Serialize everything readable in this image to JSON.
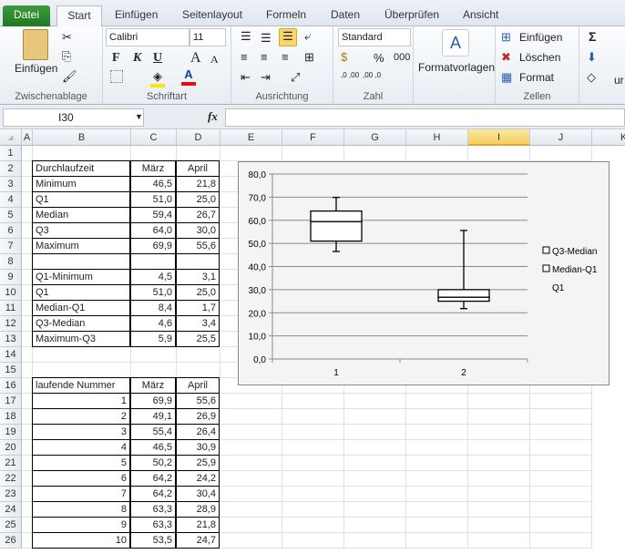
{
  "tabs": [
    "Datei",
    "Start",
    "Einfügen",
    "Seitenlayout",
    "Formeln",
    "Daten",
    "Überprüfen",
    "Ansicht"
  ],
  "ribbon": {
    "clipboard": {
      "paste": "Einfügen",
      "label": "Zwischenablage"
    },
    "font": {
      "name": "Calibri",
      "size": "11",
      "bold": "F",
      "italic": "K",
      "underline": "U",
      "grow": "A",
      "shrink": "A",
      "label": "Schriftart"
    },
    "align": {
      "label": "Ausrichtung"
    },
    "number": {
      "format": "Standard",
      "percent": "%",
      "thousands": "000",
      "inc": ",0 ,00",
      "dec": ",00 ,0",
      "label": "Zahl"
    },
    "styles": {
      "label": "Formatvorlagen"
    },
    "cells": {
      "insert": "Einfügen",
      "delete": "Löschen",
      "format": "Format",
      "label": "Zellen"
    },
    "editing": {
      "sum": "Σ",
      "more": "ur"
    }
  },
  "formula_bar": {
    "name_box": "I30",
    "fx": "fx",
    "value": ""
  },
  "columns": [
    "A",
    "B",
    "C",
    "D",
    "E",
    "F",
    "G",
    "H",
    "I",
    "J",
    "K"
  ],
  "selected_column": "I",
  "rows": [
    {
      "r": 1,
      "cells": []
    },
    {
      "r": 2,
      "cells": [
        "Durchlaufzeit",
        "März",
        "April"
      ],
      "border": true,
      "center": true
    },
    {
      "r": 3,
      "cells": [
        "Minimum",
        "46,5",
        "21,8"
      ],
      "border": true
    },
    {
      "r": 4,
      "cells": [
        "Q1",
        "51,0",
        "25,0"
      ],
      "border": true
    },
    {
      "r": 5,
      "cells": [
        "Median",
        "59,4",
        "26,7"
      ],
      "border": true
    },
    {
      "r": 6,
      "cells": [
        "Q3",
        "64,0",
        "30,0"
      ],
      "border": true
    },
    {
      "r": 7,
      "cells": [
        "Maximum",
        "69,9",
        "55,6"
      ],
      "border": true
    },
    {
      "r": 8,
      "cells": [
        "",
        "",
        ""
      ],
      "border": true
    },
    {
      "r": 9,
      "cells": [
        "Q1-Minimum",
        "4,5",
        "3,1"
      ],
      "border": true
    },
    {
      "r": 10,
      "cells": [
        "Q1",
        "51,0",
        "25,0"
      ],
      "border": true
    },
    {
      "r": 11,
      "cells": [
        "Median-Q1",
        "8,4",
        "1,7"
      ],
      "border": true
    },
    {
      "r": 12,
      "cells": [
        "Q3-Median",
        "4,6",
        "3,4"
      ],
      "border": true
    },
    {
      "r": 13,
      "cells": [
        "Maximum-Q3",
        "5,9",
        "25,5"
      ],
      "border": true
    },
    {
      "r": 14,
      "cells": []
    },
    {
      "r": 15,
      "cells": []
    },
    {
      "r": 16,
      "cells": [
        "laufende Nummer",
        "März",
        "April"
      ],
      "border": true,
      "center": true
    },
    {
      "r": 17,
      "cells": [
        "1",
        "69,9",
        "55,6"
      ],
      "border": true,
      "rightB": true
    },
    {
      "r": 18,
      "cells": [
        "2",
        "49,1",
        "26,9"
      ],
      "border": true,
      "rightB": true
    },
    {
      "r": 19,
      "cells": [
        "3",
        "55,4",
        "26,4"
      ],
      "border": true,
      "rightB": true
    },
    {
      "r": 20,
      "cells": [
        "4",
        "46,5",
        "30,9"
      ],
      "border": true,
      "rightB": true
    },
    {
      "r": 21,
      "cells": [
        "5",
        "50,2",
        "25,9"
      ],
      "border": true,
      "rightB": true
    },
    {
      "r": 22,
      "cells": [
        "6",
        "64,2",
        "24,2"
      ],
      "border": true,
      "rightB": true
    },
    {
      "r": 23,
      "cells": [
        "7",
        "64,2",
        "30,4"
      ],
      "border": true,
      "rightB": true
    },
    {
      "r": 24,
      "cells": [
        "8",
        "63,3",
        "28,9"
      ],
      "border": true,
      "rightB": true
    },
    {
      "r": 25,
      "cells": [
        "9",
        "63,3",
        "21,8"
      ],
      "border": true,
      "rightB": true
    },
    {
      "r": 26,
      "cells": [
        "10",
        "53,5",
        "24,7"
      ],
      "border": true,
      "rightB": true
    }
  ],
  "chart_data": {
    "type": "box",
    "categories": [
      "1",
      "2"
    ],
    "ylim": [
      0,
      80
    ],
    "yticks": [
      "0,0",
      "10,0",
      "20,0",
      "30,0",
      "40,0",
      "50,0",
      "60,0",
      "70,0",
      "80,0"
    ],
    "boxes": [
      {
        "min": 46.5,
        "q1": 51.0,
        "median": 59.4,
        "q3": 64.0,
        "max": 69.9
      },
      {
        "min": 21.8,
        "q1": 25.0,
        "median": 26.7,
        "q3": 30.0,
        "max": 55.6
      }
    ],
    "legend": [
      "Q3-Median",
      "Median-Q1",
      "Q1"
    ],
    "legend_position": "right"
  }
}
